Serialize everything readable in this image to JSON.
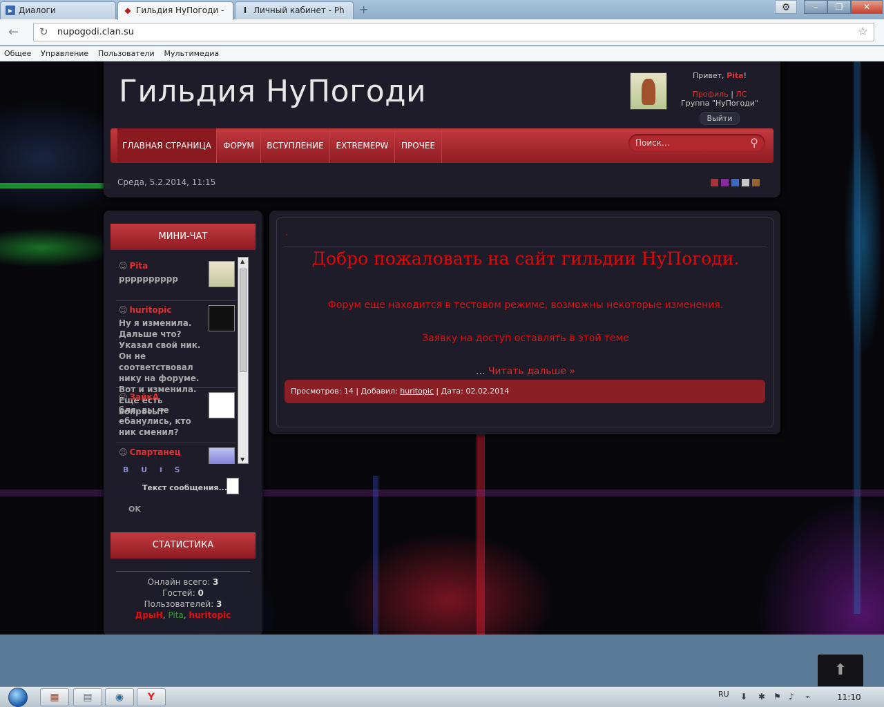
{
  "browser": {
    "tabs": [
      {
        "title": "Диалоги",
        "icon": "dialog-icon"
      },
      {
        "title": "Гильдия НуПогоди - ",
        "icon": "wolf-icon"
      },
      {
        "title": "Личный кабинет - Ph",
        "icon": "cursor-icon"
      }
    ],
    "url": "nupogodi.clan.su",
    "bookmarks": [
      "Общее",
      "Управление",
      "Пользователи",
      "Мультимедиа"
    ]
  },
  "header": {
    "site_title": "Гильдия НуПогоди",
    "hello_prefix": "Привет, ",
    "username": "Pita",
    "hello_suffix": "!",
    "profile_link": "Профиль",
    "pm_link": "ЛС",
    "group_line": "Группа \"НуПогоди\"",
    "logout": "Выйти",
    "date_line": "Среда, 5.2.2014, 11:15",
    "swatches": [
      "#b0303a",
      "#8a2aa0",
      "#3a6ac8",
      "#c8c8c8",
      "#9a6030"
    ]
  },
  "menu": {
    "items": [
      "ГЛАВНАЯ СТРАНИЦА",
      "ФОРУМ",
      "ВСТУПЛЕНИЕ",
      "EXTREMEPW",
      "ПРОЧЕЕ"
    ],
    "search_placeholder": "Поиск..."
  },
  "minichat": {
    "title": "МИНИ-ЧАТ",
    "messages": [
      {
        "author": "Pita",
        "text": "pppppppppp"
      },
      {
        "author": "huritopic",
        "text": "Ну я изменила. Дальше что? Указал свой ник. Он не соответствовал нику на форуме. Вот и изменила. Еще есть вопросы?"
      },
      {
        "author": "ЗайкА",
        "text": "бля, вы че ебанулись, кто ник сменил?"
      },
      {
        "author": "Спартанец",
        "text": ""
      }
    ],
    "format_buttons": [
      "B",
      "U",
      "i",
      "S"
    ],
    "message_placeholder": "Текст сообщения...",
    "ok": "OK"
  },
  "stats": {
    "title": "СТАТИСТИКА",
    "online_label": "Онлайн всего: ",
    "online_value": "3",
    "guests_label": "Гостей: ",
    "guests_value": "0",
    "users_label": "Пользователей: ",
    "users_value": "3",
    "users_list": [
      {
        "name": "ДрыН",
        "color": "#e01010"
      },
      {
        "name": "Pita",
        "color": "#30a030"
      },
      {
        "name": "huritopic",
        "color": "#e01010"
      }
    ]
  },
  "post": {
    "dot": ".",
    "title": "Добро пожаловать на сайт гильдии НуПогоди.",
    "line1": "Форум еще находится в тестовом режиме, возможны некоторые изменения.",
    "line2": "Заявку на доступ оставлять в этой теме",
    "read_more_dots": "...",
    "read_more": "Читать дальше »",
    "meta_views": "Просмотров: 14 | Добавил: ",
    "meta_author": "huritopic",
    "meta_date": " | Дата: 02.02.2014"
  },
  "taskbar": {
    "lang": "RU",
    "clock": "11:10"
  }
}
